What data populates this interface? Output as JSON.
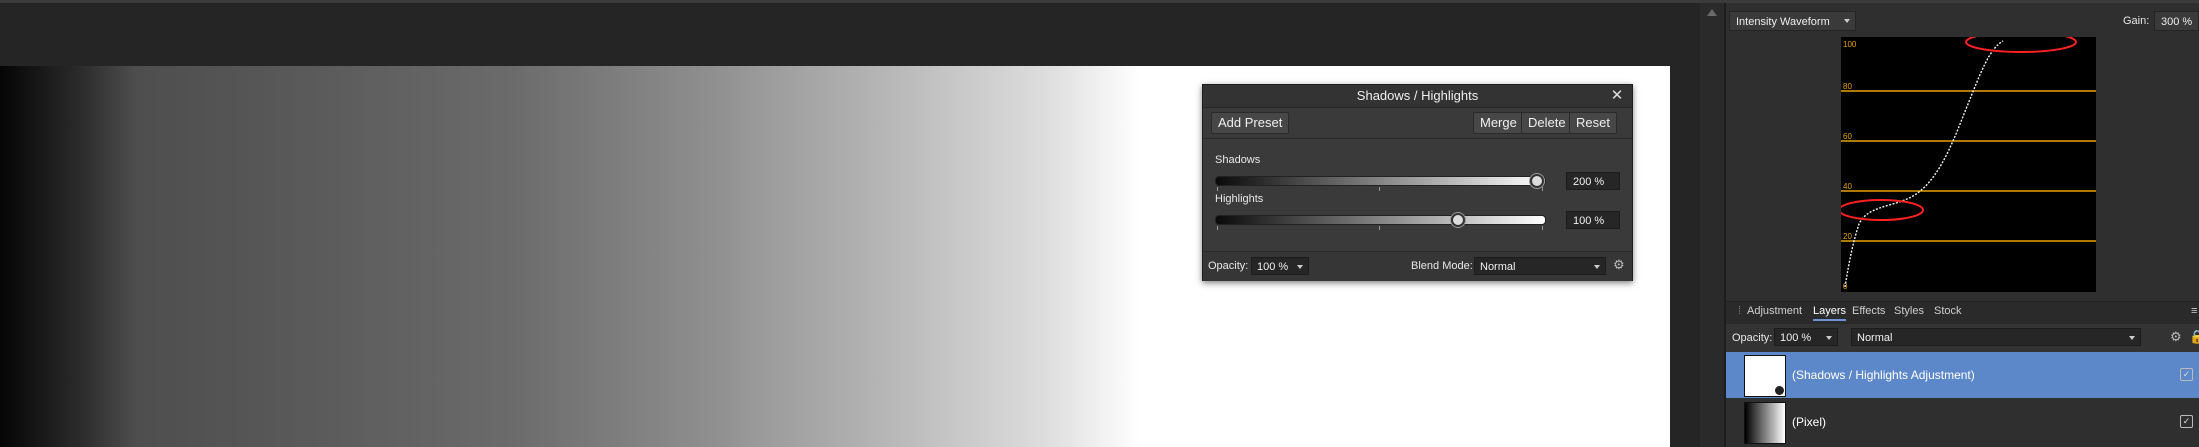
{
  "dialog": {
    "title": "Shadows / Highlights",
    "close_icon": "close-icon",
    "buttons": {
      "add_preset": "Add Preset",
      "merge": "Merge",
      "delete": "Delete",
      "reset": "Reset"
    },
    "shadows": {
      "label": "Shadows",
      "value_text": "200 %",
      "position": 1.0
    },
    "highlights": {
      "label": "Highlights",
      "value_text": "100 %",
      "position": 0.75
    },
    "opacity": {
      "label": "Opacity:",
      "value": "100 %"
    },
    "blend_mode": {
      "label": "Blend Mode:",
      "value": "Normal"
    },
    "settings_icon": "gear-icon"
  },
  "scope": {
    "mode": "Intensity Waveform",
    "gain_label": "Gain:",
    "gain_value": "300 %",
    "levels": [
      "100",
      "80",
      "60",
      "40",
      "20",
      "0"
    ],
    "line_color": "#e8a200",
    "annotation_color": "#ff2020"
  },
  "panel_tabs": [
    "Adjustment",
    "Layers",
    "Effects",
    "Styles",
    "Stock"
  ],
  "panel_active_tab": "Layers",
  "layers_bar": {
    "opacity_label": "Opacity:",
    "opacity_value": "100 %",
    "blend_value": "Normal"
  },
  "layers": [
    {
      "name": "(Shadows / Highlights Adjustment)",
      "selected": true,
      "visible": true
    },
    {
      "name": "(Pixel)",
      "selected": false,
      "visible": true
    }
  ],
  "colors": {
    "accent": "#5c88c9",
    "panel": "#2f2f2f",
    "canvas": "#ffffff"
  }
}
